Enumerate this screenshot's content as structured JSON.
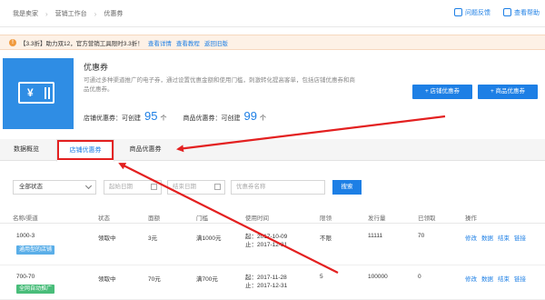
{
  "breadcrumb": {
    "items": [
      "我是卖家",
      "营销工作台",
      "优惠券"
    ]
  },
  "top_actions": {
    "feedback": "问题反馈",
    "help": "查看帮助"
  },
  "notice": {
    "text": "【3.3折】助力双12，官方营销工具限时3.3折！",
    "links": [
      "查看详情",
      "查看教程",
      "返回旧版"
    ]
  },
  "intro": {
    "title": "优惠券",
    "desc": "可通过多种渠道推广的电子券，通过设置优惠金额和使用门槛，刺激转化提高客单，包括店铺优惠券和商品优惠券。",
    "store_label": "店铺优惠券：可创建",
    "store_count": "95",
    "goods_label": "商品优惠券：可创建",
    "goods_count": "99",
    "unit": "个",
    "btn_store": "+ 店铺优惠券",
    "btn_goods": "+ 商品优惠券"
  },
  "tabs": [
    "数据概览",
    "店铺优惠券",
    "商品优惠券"
  ],
  "filters": {
    "status": "全部状态",
    "start_date": "起始日期",
    "end_date": "结束日期",
    "name_placeholder": "优惠券名称",
    "search": "搜索"
  },
  "table": {
    "headers": [
      "名称/渠道",
      "状态",
      "面额",
      "门槛",
      "使用时间",
      "限领",
      "发行量",
      "已领取",
      "操作"
    ],
    "rows": [
      {
        "name": "1000-3",
        "tag": "通用型的店铺",
        "status": "领取中",
        "amount": "3元",
        "threshold": "满1000元",
        "start": "起：2017-10-09",
        "end": "止：2017-12-31",
        "limit": "不限",
        "issued": "11111",
        "claimed": "70",
        "ops": [
          "修改",
          "数据",
          "结束",
          "链接"
        ]
      },
      {
        "name": "700-70",
        "tag": "全网自动推广",
        "status": "领取中",
        "amount": "70元",
        "threshold": "满700元",
        "start": "起：2017-11-28",
        "end": "止：2017-12-31",
        "limit": "5",
        "issued": "100000",
        "claimed": "0",
        "ops": [
          "修改",
          "数据",
          "结束",
          "链接"
        ]
      }
    ]
  },
  "colors": {
    "accent": "#1d7fe5",
    "annotation": "#e32020",
    "notice_bg": "#fdf1e6"
  }
}
